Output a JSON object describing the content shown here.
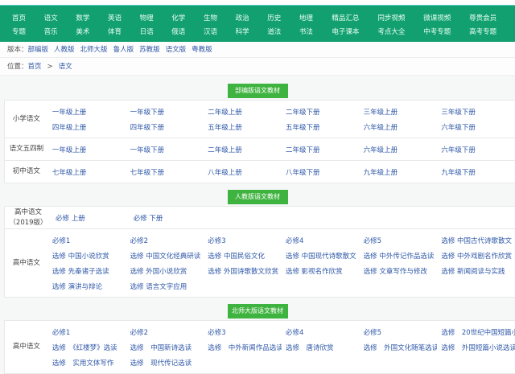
{
  "nav": {
    "rows": [
      [
        "首页",
        "语文",
        "数学",
        "英语",
        "物理",
        "化学",
        "生物",
        "政治",
        "历史",
        "地理",
        "精品汇总",
        "同步视频",
        "微课视频",
        "尊贵会员"
      ],
      [
        "专题",
        "音乐",
        "美术",
        "体育",
        "日语",
        "俄语",
        "汉语",
        "科学",
        "道法",
        "书法",
        "电子课本",
        "考点大全",
        "中考专题",
        "高考专题"
      ]
    ]
  },
  "versions": {
    "label": "版本：",
    "items": [
      "部编版",
      "人教版",
      "北师大版",
      "鲁人版",
      "苏教版",
      "语文版",
      "粤教版"
    ]
  },
  "breadcrumb": {
    "label": "位置：",
    "home": "首页",
    "sep": ">",
    "current": "语文"
  },
  "sections": [
    {
      "title": "部编版语文教材",
      "groups": [
        {
          "label": "小学语文",
          "rows": [
            [
              "一年级上册",
              "一年级下册",
              "二年级上册",
              "二年级下册",
              "三年级上册",
              "三年级下册"
            ],
            [
              "四年级上册",
              "四年级下册",
              "五年级上册",
              "五年级下册",
              "六年级上册",
              "六年级下册"
            ]
          ]
        },
        {
          "label": "语文五四制",
          "rows": [
            [
              "一年级上册",
              "一年级下册",
              "二年级上册",
              "二年级下册",
              "六年级上册",
              "六年级下册"
            ]
          ]
        },
        {
          "label": "初中语文",
          "rows": [
            [
              "七年级上册",
              "七年级下册",
              "八年级上册",
              "八年级下册",
              "九年级上册",
              "九年级下册"
            ]
          ]
        }
      ]
    },
    {
      "title": "人教版语文教材",
      "groups": [
        {
          "label": "高中语文（2019版）",
          "rows": [
            [
              "必修 上册",
              "必修 下册"
            ]
          ]
        },
        {
          "label": "高中语文",
          "rows": [
            [
              "必修1",
              "必修2",
              "必修3",
              "必修4",
              "必修5",
              "选修 中国古代诗歌散文"
            ],
            [
              "选修 中国小说欣赏",
              "选修 中国文化经典研读",
              "选修 中国民俗文化",
              "选修 中国现代诗歌散文",
              "选修 中外传记作品选读",
              "选修 中外戏剧名作欣赏"
            ],
            [
              "选修 先秦诸子选读",
              "选修 外国小说欣赏",
              "选修 外国诗歌散文欣赏",
              "选修 影视名作欣赏",
              "选修 文章写作与修改",
              "选修 新闻阅读与实践"
            ],
            [
              "选修 演讲与辩论",
              "选修 语言文字应用"
            ]
          ]
        }
      ]
    },
    {
      "title": "北师大版语文教材",
      "groups": [
        {
          "label": "高中语文",
          "rows": [
            [
              "必修1",
              "必修2",
              "必修3",
              "必修4",
              "必修5",
              "选修　20世纪中国短篇小"
            ],
            [
              "选修　《红楼梦》选读",
              "选修　中国新诗选读",
              "选修　中外新闻作品选读",
              "选修　唐诗欣赏",
              "选修　外国文化随笔选读",
              "选修　外国短篇小说选读"
            ],
            [
              "选修　实用文体写作",
              "选修　现代传记选读"
            ]
          ]
        }
      ]
    }
  ],
  "colors": {
    "nav_bg": "#13a070",
    "section_button": "#3fb33f",
    "link": "#2f58a8"
  }
}
